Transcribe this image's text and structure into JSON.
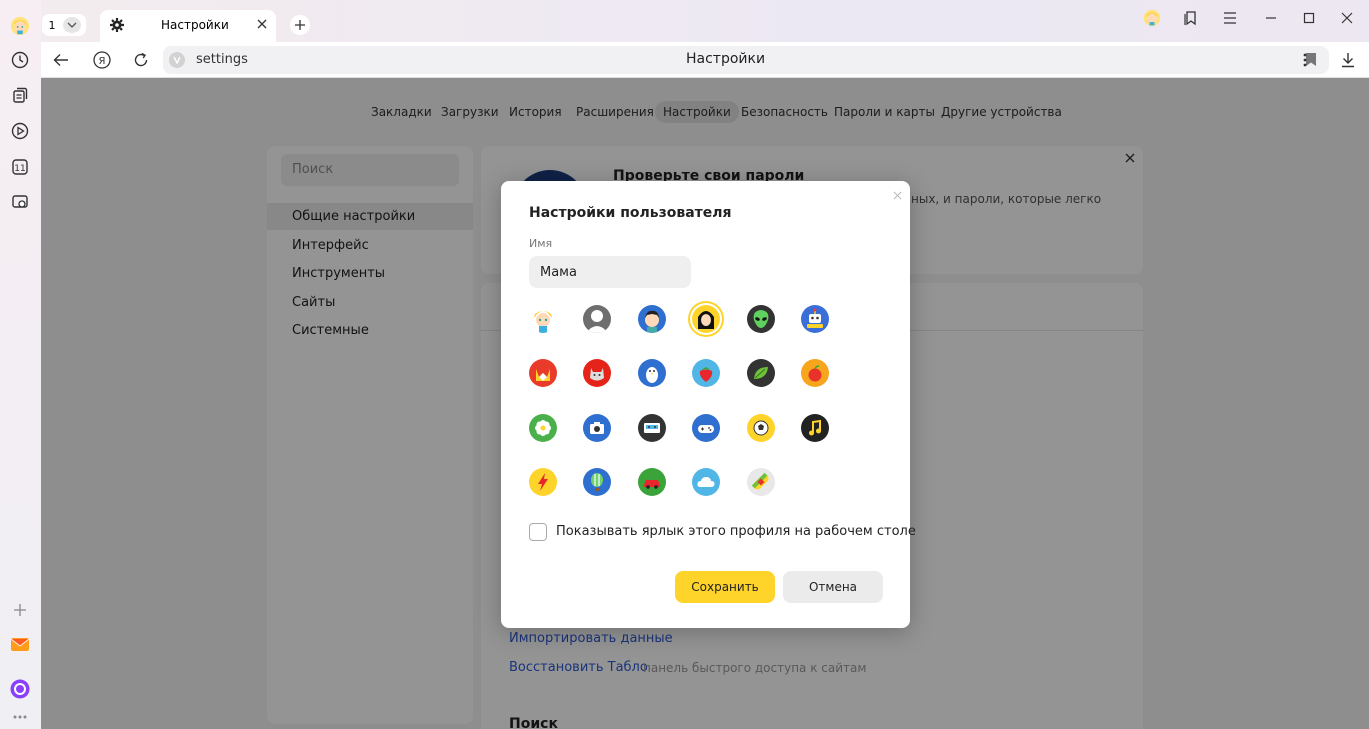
{
  "tabs": {
    "count": "1",
    "active_title": "Настройки"
  },
  "address": {
    "url": "settings",
    "page_title": "Настройки"
  },
  "settings_nav": {
    "items": [
      "Закладки",
      "Загрузки",
      "История",
      "Расширения",
      "Настройки",
      "Безопасность",
      "Пароли и карты",
      "Другие устройства"
    ],
    "active": "Настройки"
  },
  "settings_sidebar": {
    "search_placeholder": "Поиск",
    "items": [
      "Общие настройки",
      "Интерфейс",
      "Инструменты",
      "Сайты",
      "Системные"
    ],
    "selected": "Общие настройки"
  },
  "password_card": {
    "title": "Проверьте свои пароли",
    "text": "ных, и пароли, которые легко"
  },
  "general_section": {
    "import_link": "Импортировать данные",
    "restore_link": "Восстановить Табло",
    "restore_hint": "панель быстрого доступа к сайтам",
    "search_title": "Поиск"
  },
  "dialog": {
    "title": "Настройки пользователя",
    "name_label": "Имя",
    "name_value": "Мама",
    "avatars": [
      "girl-avatar",
      "default-person-avatar",
      "boy-avatar",
      "woman-avatar",
      "alien-avatar",
      "robot-avatar",
      "fox-avatar",
      "cat-avatar",
      "penguin-avatar",
      "strawberry-avatar",
      "leaf-avatar",
      "apple-avatar",
      "flower-avatar",
      "camera-avatar",
      "cassette-avatar",
      "gamepad-avatar",
      "soccer-ball-avatar",
      "music-note-avatar",
      "lightning-avatar",
      "balloon-avatar",
      "car-avatar",
      "cloud-avatar",
      "bandage-avatar"
    ],
    "selected_avatar": "woman-avatar",
    "shortcut_label": "Показывать ярлык этого профиля на рабочем столе",
    "shortcut_checked": false,
    "save_label": "Сохранить",
    "cancel_label": "Отмена"
  }
}
